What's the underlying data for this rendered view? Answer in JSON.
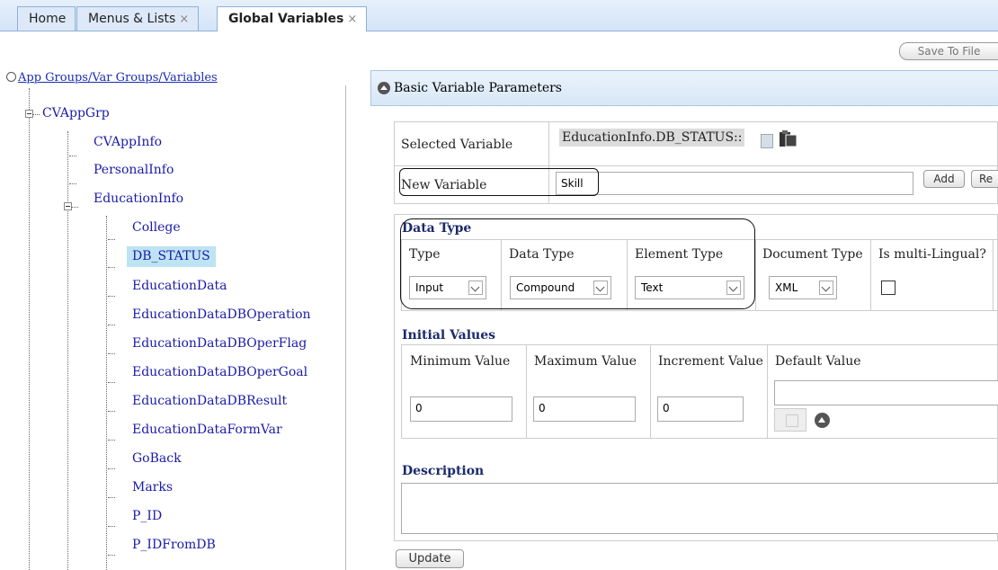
{
  "tabs": [
    {
      "label": "Home",
      "closable": false
    },
    {
      "label": "Menus & Lists",
      "closable": true
    },
    {
      "label": "Global Variables",
      "closable": true,
      "active": true
    }
  ],
  "close_glyph": "×",
  "toolbar": {
    "save_label": "Save To File"
  },
  "tree": {
    "root_label": "App Groups/Var Groups/Variables",
    "app_group": "CVAppGrp",
    "var_groups": [
      "CVAppInfo",
      "PersonalInfo",
      "EducationInfo"
    ],
    "variables": [
      "College",
      "DB_STATUS",
      "EducationData",
      "EducationDataDBOperation",
      "EducationDataDBOperFlag",
      "EducationDataDBOperGoal",
      "EducationDataDBResult",
      "EducationDataFormVar",
      "GoBack",
      "Marks",
      "P_ID",
      "P_IDFromDB"
    ],
    "selected_variable": "DB_STATUS"
  },
  "panel": {
    "title": "Basic Variable Parameters",
    "selected_variable_label": "Selected Variable",
    "selected_variable_value": "EducationInfo.DB_STATUS::",
    "new_variable_label": "New Variable",
    "new_variable_value": "Skill",
    "add_label": "Add",
    "re_label": "Re"
  },
  "data_type": {
    "section_title": "Data Type",
    "columns": [
      {
        "header": "Type",
        "selected": "Input"
      },
      {
        "header": "Data Type",
        "selected": "Compound"
      },
      {
        "header": "Element Type",
        "selected": "Text"
      },
      {
        "header": "Document Type",
        "selected": "XML"
      },
      {
        "header": "Is multi-Lingual?",
        "checked": false
      }
    ]
  },
  "initial_values": {
    "section_title": "Initial Values",
    "min_label": "Minimum Value",
    "min_value": "0",
    "max_label": "Maximum Value",
    "max_value": "0",
    "inc_label": "Increment Value",
    "inc_value": "0",
    "default_label": "Default Value",
    "default_value": ""
  },
  "description": {
    "section_title": "Description",
    "value": ""
  },
  "update_label": "Update",
  "icons": [
    "refresh-icon",
    "collapse-icon",
    "copy-icon",
    "paste-icon",
    "up-arrow-icon",
    "checkbox-icon"
  ]
}
